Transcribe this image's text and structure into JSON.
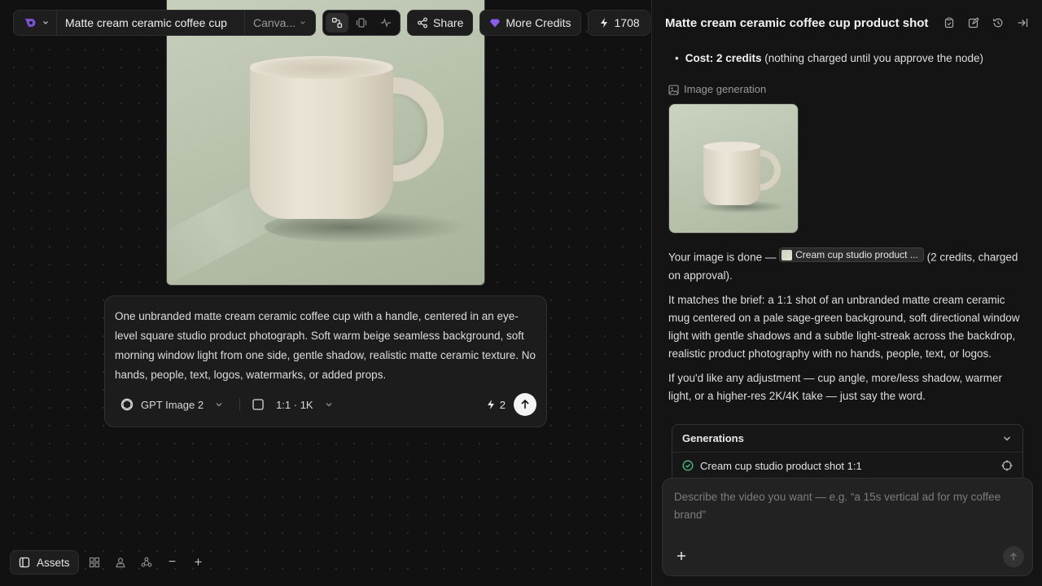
{
  "topbar": {
    "doc_title": "Matte cream ceramic coffee cup",
    "mode_label": "Canva...",
    "share_label": "Share",
    "more_credits_label": "More Credits",
    "balance": "1708",
    "avatar_initial": "S",
    "accent": "#7a52d8"
  },
  "canvas": {
    "prompt": {
      "text": "One unbranded matte cream ceramic coffee cup with a handle, centered in an eye-level square studio product photograph. Soft warm beige seamless background, soft morning window light from one side, gentle shadow, realistic matte ceramic texture. No hands, people, text, logos, watermarks, or added props.",
      "model": "GPT Image 2",
      "ratio": "1:1 · 1K",
      "cost": "2"
    },
    "bottom_bar": {
      "assets_label": "Assets",
      "zoom_out": "−",
      "zoom_in": "+"
    }
  },
  "panel": {
    "title": "Matte cream ceramic coffee cup product shot",
    "bullet_bold": "Cost: 2 credits",
    "bullet_rest": "(nothing charged until you approve the node)",
    "image_gen_label": "Image generation",
    "done_prefix": "Your image is done —",
    "chip_label": "Cream cup studio product ...",
    "done_suffix": "(2 credits, charged on approval).",
    "para2": "It matches the brief: a 1:1 shot of an unbranded matte cream ceramic mug centered on a pale sage-green background, soft directional window light with gentle shadows and a subtle light-streak across the backdrop, realistic product photography with no hands, people, text, or logos.",
    "para3": "If you'd like any adjustment — cup angle, more/less shadow, warmer light, or a higher-res 2K/4K take — just say the word.",
    "generations": {
      "header": "Generations",
      "item": "Cream cup studio product shot 1:1",
      "status_color": "#4cc38a"
    },
    "composer": {
      "placeholder": "Describe the video you want — e.g. “a 15s vertical ad for my coffee brand”"
    }
  }
}
